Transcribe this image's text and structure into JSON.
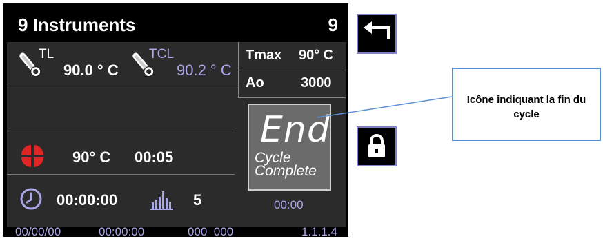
{
  "header": {
    "title": "9 Instruments",
    "count": "9"
  },
  "sensors": {
    "tl": {
      "label": "TL",
      "value": "90.0 ° C"
    },
    "tcl": {
      "label": "TCL",
      "value": "90.2 ° C"
    }
  },
  "limits": {
    "tmax_label": "Tmax",
    "tmax_value": "90° C",
    "ao_label": "Ao",
    "ao_value": "3000"
  },
  "status": {
    "end_text": "End",
    "cycle_line1": "Cycle",
    "cycle_line2": "Complete",
    "time": "00:00"
  },
  "fan": {
    "temp": "90° C",
    "time": "00:05",
    "icon": "fan-icon"
  },
  "clock": {
    "elapsed": "00:00:00",
    "icon": "clock-icon"
  },
  "load": {
    "value": "5",
    "icon": "bar-chart-icon"
  },
  "footer": {
    "date": "00/00/00",
    "time": "00:00:00",
    "code": "000  000",
    "version": "1.1.1.4"
  },
  "side_buttons": {
    "back_icon": "back-arrow-icon",
    "lock_icon": "lock-icon"
  },
  "callout": {
    "text": "Icône indiquant la fin du cycle"
  },
  "colors": {
    "accent_purple": "#a9a7e8",
    "fan_red": "#e02525",
    "callout_border": "#5b8fd1"
  }
}
